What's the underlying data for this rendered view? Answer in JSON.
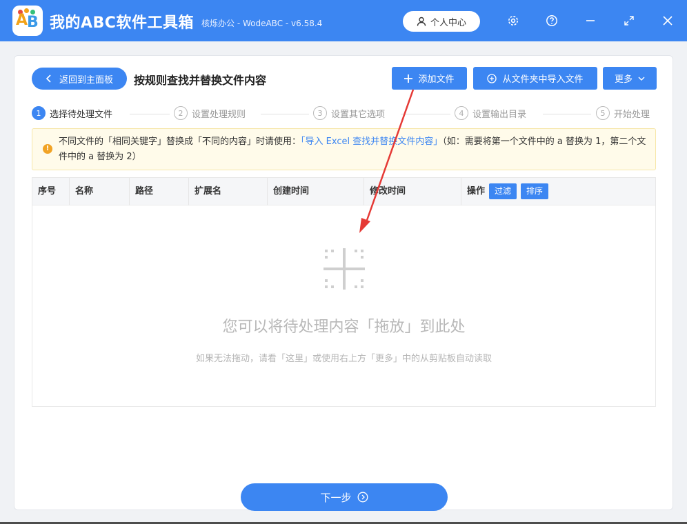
{
  "app": {
    "title": "我的ABC软件工具箱",
    "subtitle": "核烁办公 - WodeABC - v6.58.4",
    "user_center": "个人中心",
    "brand_colors": {
      "primary": "#3c86f2",
      "logo_orange": "#f2a31a",
      "logo_blue": "#3b9ae8"
    }
  },
  "window_controls": [
    "gear-icon",
    "help-icon",
    "minimize-icon",
    "maximize-icon",
    "close-icon"
  ],
  "header": {
    "back_label": "返回到主面板",
    "page_title": "按规则查找并替换文件内容",
    "add_file": "添加文件",
    "import_folder": "从文件夹中导入文件",
    "more": "更多"
  },
  "steps": [
    {
      "num": "1",
      "label": "选择待处理文件",
      "active": true
    },
    {
      "num": "2",
      "label": "设置处理规则",
      "active": false
    },
    {
      "num": "3",
      "label": "设置其它选项",
      "active": false
    },
    {
      "num": "4",
      "label": "设置输出目录",
      "active": false
    },
    {
      "num": "5",
      "label": "开始处理",
      "active": false
    }
  ],
  "notice": {
    "text_before": "不同文件的「相同关键字」替换成「不同的内容」时请使用：",
    "link": "「导入 Excel 查找并替换文件内容」",
    "text_after": "（如：需要将第一个文件中的 a 替换为 1，第二个文件中的 a 替换为 2）"
  },
  "table": {
    "columns": [
      "序号",
      "名称",
      "路径",
      "扩展名",
      "创建时间",
      "修改时间",
      "操作"
    ],
    "filter_btn": "过滤",
    "sort_btn": "排序"
  },
  "drop": {
    "title": "您可以将待处理内容「拖放」到此处",
    "hint": "如果无法拖动，请看「这里」或使用右上方「更多」中的从剪贴板自动读取"
  },
  "footer": {
    "next": "下一步"
  }
}
